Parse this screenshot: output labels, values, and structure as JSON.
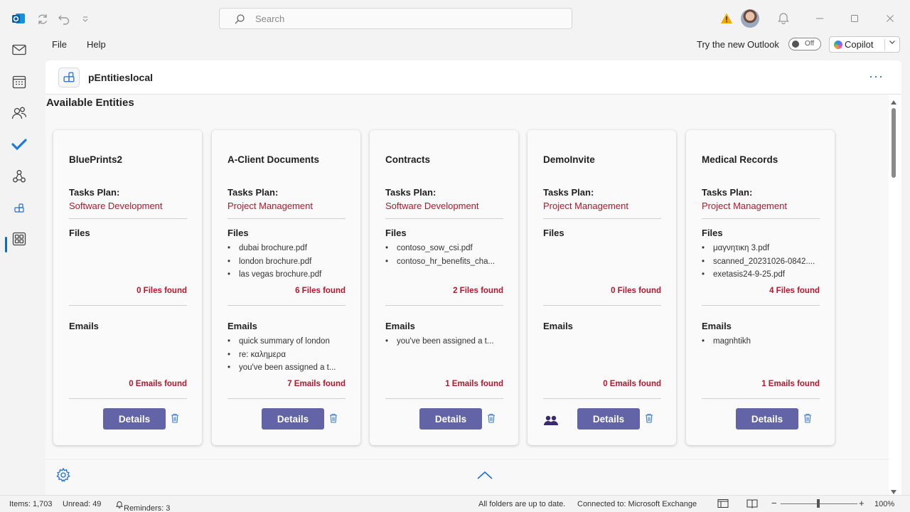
{
  "titlebar": {
    "search_placeholder": "Search"
  },
  "menu": {
    "file": "File",
    "help": "Help",
    "try_new_outlook": "Try the new Outlook",
    "toggle_state": "Off",
    "copilot": "Copilot"
  },
  "panel": {
    "title": "pEntitieslocal",
    "section_title": "Available Entities"
  },
  "labels": {
    "tasks_plan": "Tasks Plan:",
    "files": "Files",
    "emails": "Emails",
    "details": "Details"
  },
  "cards": [
    {
      "name": "BluePrints2",
      "plan": "Software Development",
      "files": [],
      "files_count": "0 Files found",
      "emails": [],
      "emails_count": "0 Emails found"
    },
    {
      "name": "A-Client Documents",
      "plan": "Project Management",
      "files": [
        "dubai brochure.pdf",
        "london brochure.pdf",
        "las vegas brochure.pdf"
      ],
      "files_count": "6 Files found",
      "emails": [
        "quick summary of london",
        "re: καλημερα",
        "you've been assigned a t..."
      ],
      "emails_count": "7 Emails found"
    },
    {
      "name": "Contracts",
      "plan": "Software Development",
      "files": [
        "contoso_sow_csi.pdf",
        "contoso_hr_benefits_cha..."
      ],
      "files_count": "2 Files found",
      "emails": [
        "you've been assigned a t..."
      ],
      "emails_count": "1 Emails found"
    },
    {
      "name": "DemoInvite",
      "plan": "Project Management",
      "files": [],
      "files_count": "0 Files found",
      "emails": [],
      "emails_count": "0 Emails found",
      "shared": true
    },
    {
      "name": "Medical Records",
      "plan": "Project Management",
      "files": [
        "μαγνητικη 3.pdf",
        "scanned_20231026-0842....",
        "exetasis24-9-25.pdf"
      ],
      "files_count": "4 Files found",
      "emails": [
        "magnhtikh"
      ],
      "emails_count": "1 Emails found"
    }
  ],
  "statusbar": {
    "items": "Items: 1,703",
    "unread": "Unread: 49",
    "reminders": "Reminders: 3",
    "sync": "All folders are up to date.",
    "connection": "Connected to: Microsoft Exchange",
    "zoom": "100%"
  },
  "colors": {
    "accent": "#0f6cbd",
    "button": "#6264a7",
    "highlight_red": "#b4172d"
  }
}
